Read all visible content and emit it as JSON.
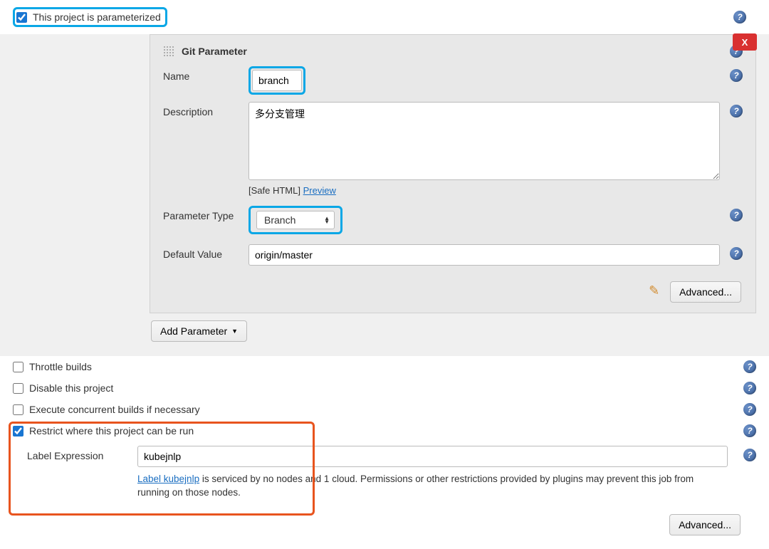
{
  "options": {
    "parameterized": {
      "label": "This project is parameterized",
      "checked": true
    },
    "throttle": {
      "label": "Throttle builds",
      "checked": false
    },
    "disable": {
      "label": "Disable this project",
      "checked": false
    },
    "concurrent": {
      "label": "Execute concurrent builds if necessary",
      "checked": false
    },
    "restrict": {
      "label": "Restrict where this project can be run",
      "checked": true
    }
  },
  "gitParameter": {
    "title": "Git Parameter",
    "close": "X",
    "nameLabel": "Name",
    "nameValue": "branch",
    "descLabel": "Description",
    "descValue": "多分支管理",
    "safeHtmlLabel": "[Safe HTML]",
    "previewLink": "Preview",
    "typeLabel": "Parameter Type",
    "typeValue": "Branch",
    "defaultLabel": "Default Value",
    "defaultValue": "origin/master",
    "advancedLabel": "Advanced..."
  },
  "addParameterLabel": "Add Parameter",
  "labelExpression": {
    "label": "Label Expression",
    "value": "kubejnlp",
    "noteLink": "Label kubejnlp",
    "noteRest": " is serviced by no nodes and 1 cloud. Permissions or other restrictions provided by plugins may prevent this job from running on those nodes."
  },
  "bottomAdvanced": "Advanced..."
}
